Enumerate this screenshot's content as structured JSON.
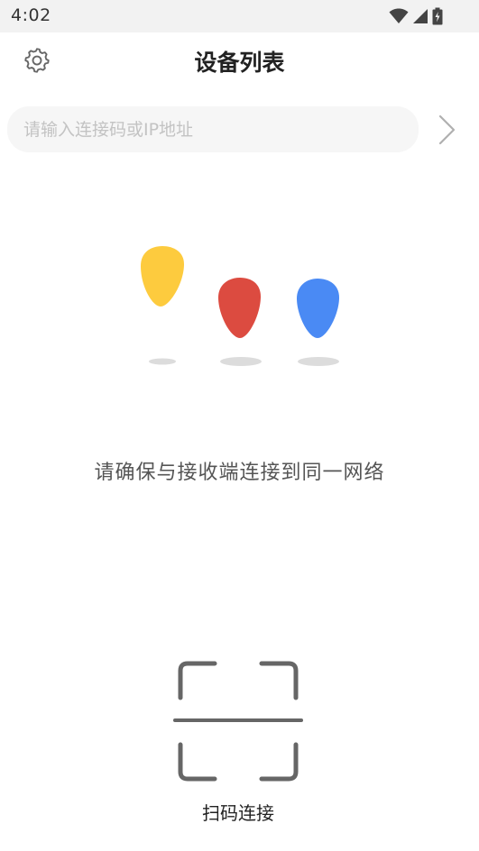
{
  "status_bar": {
    "time": "4:02",
    "icons": [
      "wifi-icon",
      "signal-icon",
      "battery-icon"
    ]
  },
  "header": {
    "title": "设备列表",
    "settings_icon": "gear-icon"
  },
  "search": {
    "value": "",
    "placeholder": "请输入连接码或IP地址",
    "submit_icon": "chevron-right-icon"
  },
  "illustration": {
    "pins": [
      {
        "name": "yellow-pin-icon",
        "color": "#FDCB3E"
      },
      {
        "name": "red-pin-icon",
        "color": "#DC4B40"
      },
      {
        "name": "blue-pin-icon",
        "color": "#4A8AF4"
      }
    ]
  },
  "main": {
    "hint": "请确保与接收端连接到同一网络"
  },
  "scan": {
    "label": "扫码连接",
    "icon": "scan-frame-icon"
  },
  "colors": {
    "icon_gray": "#666666",
    "placeholder": "#c3c3c3",
    "field_bg": "#f6f6f6"
  }
}
